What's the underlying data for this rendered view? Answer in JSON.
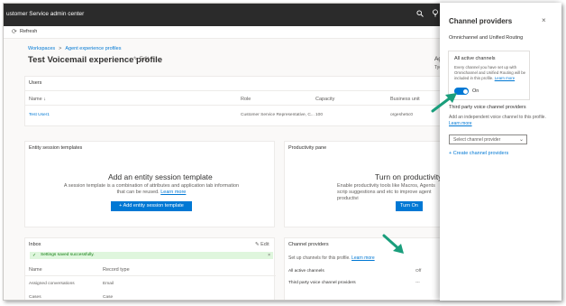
{
  "app": {
    "title": "ustomer Service admin center"
  },
  "topbar_icons": [
    "search-icon",
    "lightbulb-icon"
  ],
  "command_bar": {
    "refresh_label": "Refresh"
  },
  "breadcrumb": {
    "items": [
      "Workspaces",
      "Agent experience profiles"
    ]
  },
  "page": {
    "title": "Test Voicemail experience profile",
    "edit_label": "Edit",
    "side_label": "Age",
    "side_sub": "Tye"
  },
  "users_card": {
    "title": "Users",
    "columns": [
      "Name ↓",
      "Role",
      "Capacity",
      "Business unit"
    ],
    "rows": [
      [
        "Test User1",
        "Customer Service Representative, C...",
        "100",
        "orgeshe5c0"
      ]
    ]
  },
  "entity_card": {
    "title": "Entity session templates",
    "heading": "Add an entity session template",
    "description": "A session template is a combination of attributes and application tab information that can be reused.",
    "learn_more": "Learn more",
    "button_label": "+ Add entity session template"
  },
  "productivity_card": {
    "title": "Productivity pane",
    "heading": "Turn on productivity pane",
    "description": "Enable productivity tools like Macros, Agents scrip suggestions and etc to improve agent productivi",
    "button_label": "Turn On"
  },
  "inbox_card": {
    "title": "Inbox",
    "edit_label": "Edit",
    "banner": "Settings saved successfully.",
    "columns": [
      "Name",
      "Record type"
    ],
    "rows": [
      [
        "Assigned conversations",
        "Email"
      ],
      [
        "Cases",
        "Case"
      ]
    ]
  },
  "channel_card": {
    "title": "Channel providers",
    "description": "Set up channels for this profile.",
    "learn_more": "Learn more",
    "rows": [
      [
        "All active channels",
        "Off"
      ],
      [
        "Third party voice channel providers",
        "---"
      ]
    ]
  },
  "panel": {
    "title": "Channel providers",
    "close": "×",
    "subheading": "Omnichannel and Unified Routing",
    "box_title": "All active channels",
    "box_desc": "Every channel you have set up with Omnichannel and Unified Routing will be included in this profile.",
    "box_learn_more": "Learn more",
    "toggle_label": "On",
    "toggle_on": true,
    "third_party_heading": "Third party voice channel providers",
    "third_party_desc": "Add an independent voice channel to this profile.",
    "third_party_learn_more": "Learn more",
    "select_placeholder": "Select channel provider",
    "create_link": "Create channel providers"
  },
  "colors": {
    "accent": "#0078d4",
    "topbar": "#2b2b2b",
    "arrow": "#1a9e7c",
    "success_bg": "#dff6dd"
  }
}
